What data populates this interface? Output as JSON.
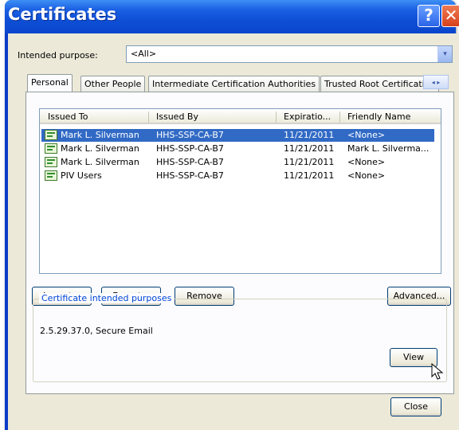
{
  "window": {
    "title": "Certificates",
    "help_glyph": "?",
    "close_glyph": "✕"
  },
  "purpose": {
    "label": "Intended purpose:",
    "value": "<All>",
    "dropdown_glyph": "▾"
  },
  "tabs": [
    {
      "label": "Personal",
      "active": true
    },
    {
      "label": "Other People",
      "active": false
    },
    {
      "label": "Intermediate Certification Authorities",
      "active": false
    },
    {
      "label": "Trusted Root Certification",
      "active": false
    }
  ],
  "tab_scroll_glyph": "◂ ▸",
  "columns": [
    "Issued To",
    "Issued By",
    "Expiratio...",
    "Friendly Name"
  ],
  "rows": [
    {
      "issued_to": "Mark L. Silverman",
      "issued_by": "HHS-SSP-CA-B7",
      "expiration": "11/21/2011",
      "friendly_name": "<None>",
      "selected": true
    },
    {
      "issued_to": "Mark L. Silverman",
      "issued_by": "HHS-SSP-CA-B7",
      "expiration": "11/21/2011",
      "friendly_name": "Mark L. Silverma...",
      "selected": false
    },
    {
      "issued_to": "Mark L. Silverman",
      "issued_by": "HHS-SSP-CA-B7",
      "expiration": "11/21/2011",
      "friendly_name": "<None>",
      "selected": false
    },
    {
      "issued_to": "PIV Users",
      "issued_by": "HHS-SSP-CA-B7",
      "expiration": "11/21/2011",
      "friendly_name": "<None>",
      "selected": false
    }
  ],
  "buttons": {
    "import": "Import...",
    "export": "Export...",
    "remove": "Remove",
    "advanced": "Advanced...",
    "view": "View",
    "close": "Close"
  },
  "purposes_group": {
    "title": "Certificate intended purposes",
    "value": "2.5.29.37.0, Secure Email"
  },
  "colors": {
    "titlebar": "#0a46cc",
    "selection": "#316ac5",
    "dialog_face": "#ece9d8",
    "group_title": "#0046d5"
  }
}
